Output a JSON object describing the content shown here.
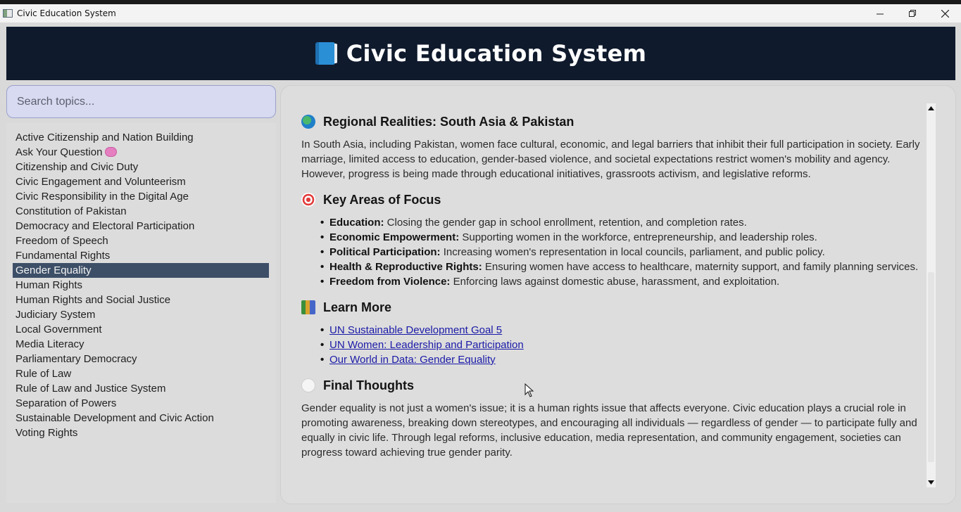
{
  "window": {
    "title": "Civic Education System",
    "controls": {
      "minimize": "─",
      "restore": "❐",
      "close": "✕"
    }
  },
  "header": {
    "title": "Civic Education System",
    "icon": "blue-book-icon"
  },
  "search": {
    "placeholder": "Search topics..."
  },
  "sidebar": {
    "selected": "Gender Equality",
    "items": [
      {
        "label": "Active Citizenship and Nation Building"
      },
      {
        "label": "Ask Your Question",
        "icon": "brain-icon"
      },
      {
        "label": "Citizenship and Civic Duty"
      },
      {
        "label": "Civic Engagement and Volunteerism"
      },
      {
        "label": "Civic Responsibility in the Digital Age"
      },
      {
        "label": "Constitution of Pakistan"
      },
      {
        "label": "Democracy and Electoral Participation"
      },
      {
        "label": "Freedom of Speech"
      },
      {
        "label": "Fundamental Rights"
      },
      {
        "label": "Gender Equality"
      },
      {
        "label": "Human Rights"
      },
      {
        "label": "Human Rights and Social Justice"
      },
      {
        "label": "Judiciary System"
      },
      {
        "label": "Local Government"
      },
      {
        "label": "Media Literacy"
      },
      {
        "label": "Parliamentary Democracy"
      },
      {
        "label": "Rule of Law"
      },
      {
        "label": "Rule of Law and Justice System"
      },
      {
        "label": "Separation of Powers"
      },
      {
        "label": "Sustainable Development and Civic Action"
      },
      {
        "label": "Voting Rights"
      }
    ]
  },
  "content": {
    "regional": {
      "heading": "Regional Realities: South Asia & Pakistan",
      "icon": "globe-icon",
      "text": "In South Asia, including Pakistan, women face cultural, economic, and legal barriers that inhibit their full participation in society. Early marriage, limited access to education, gender-based violence, and societal expectations restrict women's mobility and agency. However, progress is being made through educational initiatives, grassroots activism, and legislative reforms."
    },
    "focus": {
      "heading": "Key Areas of Focus",
      "icon": "target-icon",
      "items": [
        {
          "term": "Education:",
          "text": " Closing the gender gap in school enrollment, retention, and completion rates."
        },
        {
          "term": "Economic Empowerment:",
          "text": " Supporting women in the workforce, entrepreneurship, and leadership roles."
        },
        {
          "term": "Political Participation:",
          "text": " Increasing women's representation in local councils, parliament, and public policy."
        },
        {
          "term": "Health & Reproductive Rights:",
          "text": " Ensuring women have access to healthcare, maternity support, and family planning services."
        },
        {
          "term": "Freedom from Violence:",
          "text": " Enforcing laws against domestic abuse, harassment, and exploitation."
        }
      ]
    },
    "learn": {
      "heading": "Learn More",
      "icon": "books-icon",
      "links": [
        "UN Sustainable Development Goal 5",
        "UN Women: Leadership and Participation",
        "Our World in Data: Gender Equality"
      ]
    },
    "final": {
      "heading": "Final Thoughts",
      "icon": "speech-bubble-icon",
      "text": "Gender equality is not just a women's issue; it is a human rights issue that affects everyone. Civic education plays a crucial role in promoting awareness, breaking down stereotypes, and encouraging all individuals — regardless of gender — to participate fully and equally in civic life. Through legal reforms, inclusive education, media representation, and community engagement, societies can progress toward achieving true gender parity."
    }
  },
  "colors": {
    "header_bg": "#0f1a2c",
    "selected_bg": "#3d4f67",
    "link": "#1a1aa8",
    "search_bg": "#d7daf0"
  }
}
